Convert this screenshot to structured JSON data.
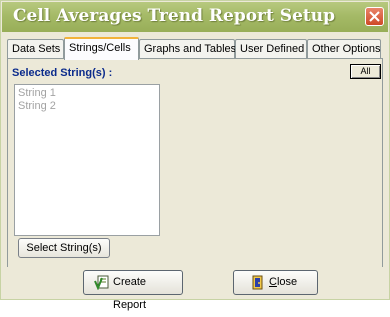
{
  "window": {
    "title": "Cell Averages Trend Report Setup"
  },
  "tabs": [
    {
      "label": "Data Sets"
    },
    {
      "label": "Strings/Cells"
    },
    {
      "label": "Graphs and Tables"
    },
    {
      "label": "User Defined"
    },
    {
      "label": "Other Options"
    }
  ],
  "strings_panel": {
    "label": "Selected String(s) :",
    "all_button": "All",
    "list_items": [
      "String 1",
      "String 2"
    ],
    "select_button": "Select String(s)"
  },
  "footer": {
    "create_report": "Create Report",
    "close_prefix": "",
    "close_accel": "C",
    "close_rest": "lose"
  },
  "colors": {
    "title_bar": "#a5ba67",
    "tab_active_accent": "#f2b33a",
    "label_blue": "#0b2b8c"
  }
}
